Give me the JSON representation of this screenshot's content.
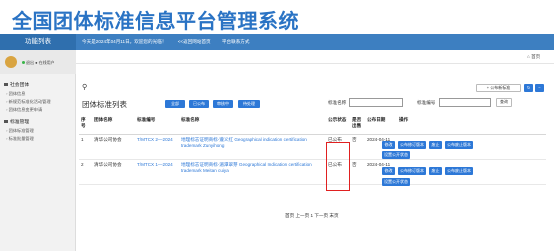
{
  "banner": {
    "title": "全国团体标准信息平台管理系统"
  },
  "topbar": {
    "menu_title": "功能列表",
    "welcome": "今天是2024年04月11日。欢迎您的光临！",
    "home_link": "<<返回网站首页",
    "contact_link": "平台联系方式"
  },
  "user": {
    "status": "退出 ● 在线用户"
  },
  "sidebar": {
    "groups": [
      {
        "label": "社会团体",
        "items": [
          "团体信息",
          "新规范标准化活动管理",
          "团体信息变更申请"
        ]
      },
      {
        "label": "标准管理",
        "items": [
          "团体标准管理",
          "标准批量管理"
        ]
      }
    ]
  },
  "header": {
    "home": "首页"
  },
  "toolbar": {
    "add_label": "+ 公布新标准",
    "refresh_icon": "refresh-icon",
    "collapse_icon": "minus-icon"
  },
  "list": {
    "title": "团体标准列表",
    "filters": [
      "全部",
      "已公布",
      "审核中",
      "待处理"
    ],
    "std_name_label": "标准名称",
    "std_number_label": "标准编号",
    "search_label": "查询"
  },
  "table": {
    "columns": [
      "序号",
      "团体名称",
      "标准编号",
      "标准名称",
      "公示状态",
      "是否出售",
      "公布日期",
      "操作"
    ],
    "rows": [
      {
        "index": "1",
        "group": "清华公司协会",
        "number": "T/MTCX 2—2024",
        "name": "地理标志证明商标-遵义红 Geographical indication certification trademark Zunyihong",
        "status": "已公布",
        "sale": "否",
        "date": "2024-04-11",
        "ops": [
          "修改",
          "公布修订版本",
          "废止",
          "公布废止版本",
          "设置公开状态"
        ]
      },
      {
        "index": "2",
        "group": "清华公司协会",
        "number": "T/MTCX 1—2024",
        "name": "地理标志证明商标-湄潭翠芽 Geographical Indication certification trademark Meitan cuiya",
        "status": "已公布",
        "sale": "否",
        "date": "2024-04-11",
        "ops": [
          "修改",
          "公布修订版本",
          "废止",
          "公布废止版本",
          "设置公开状态"
        ]
      }
    ]
  },
  "pager": {
    "text": "首页 上一页 1 下一页 末页"
  }
}
